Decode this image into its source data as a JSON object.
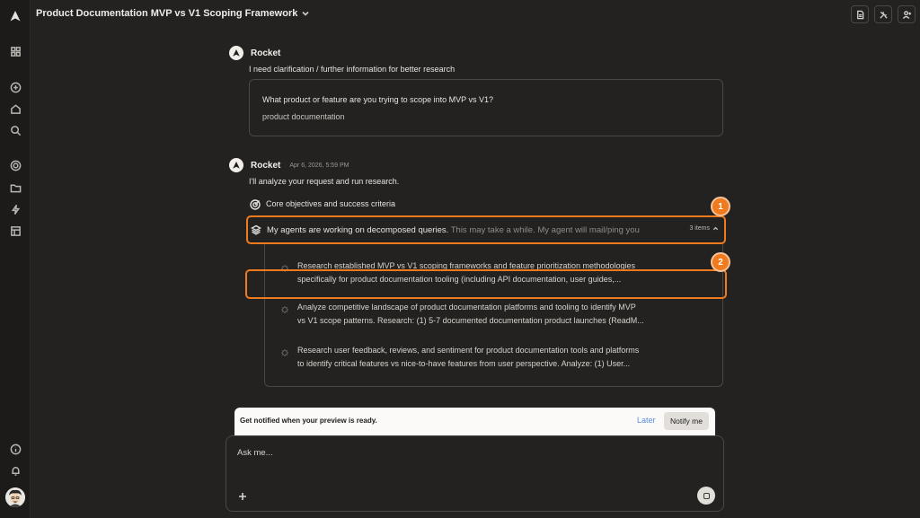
{
  "app": {
    "title": "Product Documentation MVP vs V1 Scoping Framework"
  },
  "sidebar": {
    "items": [
      {
        "icon": "rocket-logo-icon"
      },
      {
        "icon": "grid-icon"
      },
      {
        "icon": "plus-circle-icon"
      },
      {
        "icon": "home-icon"
      },
      {
        "icon": "search-icon"
      },
      {
        "icon": "target-icon"
      },
      {
        "icon": "folder-icon"
      },
      {
        "icon": "bolt-icon"
      },
      {
        "icon": "layout-icon"
      },
      {
        "icon": "info-icon"
      },
      {
        "icon": "bell-icon"
      },
      {
        "icon": "avatar"
      }
    ]
  },
  "toolbar": {
    "buttons": [
      {
        "icon": "document-icon"
      },
      {
        "icon": "tools-icon"
      },
      {
        "icon": "add-user-icon"
      }
    ]
  },
  "messages": {
    "first": {
      "sender": "Rocket",
      "text": "I need clarification / further information for better research",
      "question": "What product or feature are you trying to scope into MVP vs V1?",
      "answer": "product documentation"
    },
    "second": {
      "sender": "Rocket",
      "timestamp": "Apr 6, 2026, 5:59 PM",
      "text": "I'll analyze your request and run research.",
      "objectives_label": "Core objectives and success criteria",
      "agents_text": "My agents are working on decomposed queries.",
      "agents_text_dim": " This may take a while. My agent will mail/ping you",
      "items_count": "3 items",
      "tasks": [
        {
          "line1": "Research established MVP vs V1 scoping frameworks and feature prioritization methodologies",
          "line2": "specifically for product documentation tooling (including API documentation, user guides,..."
        },
        {
          "line1": "Analyze competitive landscape of product documentation platforms and tooling to identify MVP",
          "line2": "vs V1 scope patterns. Research: (1) 5-7 documented documentation product launches (ReadM..."
        },
        {
          "line1": "Research user feedback, reviews, and sentiment for product documentation tools and platforms",
          "line2": "to identify critical features vs nice-to-have features from user perspective. Analyze: (1) User..."
        }
      ]
    }
  },
  "annotations": {
    "badge1": "1",
    "badge2": "2",
    "color": "#f07a1e"
  },
  "notify": {
    "text": "Get notified when your preview is ready.",
    "later": "Later",
    "button": "Notify me"
  },
  "composer": {
    "placeholder": "Ask me..."
  }
}
